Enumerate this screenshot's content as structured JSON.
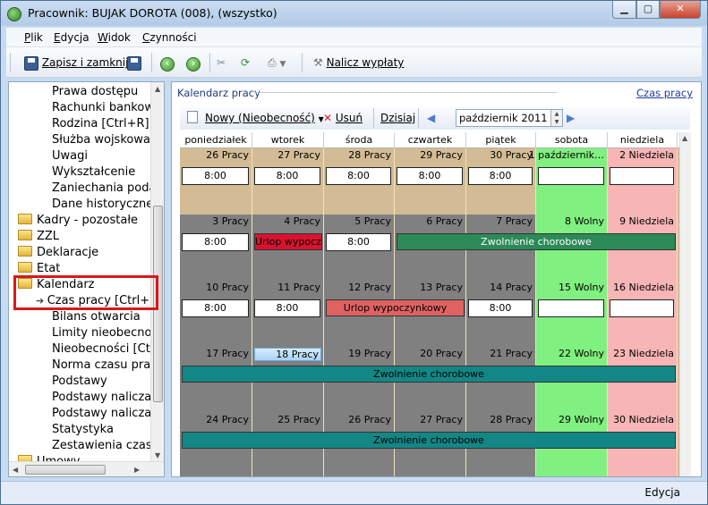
{
  "window": {
    "title": "Pracownik: BUJAK DOROTA (008), (wszystko)"
  },
  "menu": [
    {
      "label": "Plik",
      "key": "P",
      "rest": "lik"
    },
    {
      "label": "Edycja",
      "key": "E",
      "rest": "dycja"
    },
    {
      "label": "Widok",
      "key": "W",
      "rest": "idok"
    },
    {
      "label": "Czynności",
      "key": "C",
      "rest": "zynności"
    }
  ],
  "toolbar": {
    "save_close": "Zapisz i zamknij",
    "nalicz": "Nalicz wypłaty"
  },
  "tree": {
    "items": [
      {
        "label": "Prawa dostępu",
        "type": "item"
      },
      {
        "label": "Rachunki bankowe",
        "type": "item"
      },
      {
        "label": "Rodzina [Ctrl+R]",
        "type": "item"
      },
      {
        "label": "Służba wojskowa",
        "type": "item"
      },
      {
        "label": "Uwagi",
        "type": "item"
      },
      {
        "label": "Wykształcenie",
        "type": "item"
      },
      {
        "label": "Zaniechania poda",
        "type": "item"
      },
      {
        "label": "Dane historyczne",
        "type": "item"
      },
      {
        "label": "Kadry - pozostałe",
        "type": "folder"
      },
      {
        "label": "ZZL",
        "type": "folder"
      },
      {
        "label": "Deklaracje",
        "type": "folder"
      },
      {
        "label": "Etat",
        "type": "folder"
      },
      {
        "label": "Kalendarz",
        "type": "folder-open"
      },
      {
        "label": "Czas pracy [Ctrl+L]",
        "type": "selected"
      },
      {
        "label": "Bilans otwarcia",
        "type": "item"
      },
      {
        "label": "Limity nieobecności",
        "type": "item"
      },
      {
        "label": "Nieobecności [Ctrl",
        "type": "item"
      },
      {
        "label": "Norma czasu prac",
        "type": "item"
      },
      {
        "label": "Podstawy",
        "type": "item"
      },
      {
        "label": "Podstawy naliczan",
        "type": "item"
      },
      {
        "label": "Podstawy naliczan",
        "type": "item"
      },
      {
        "label": "Statystyka",
        "type": "item"
      },
      {
        "label": "Zestawienia czasu",
        "type": "item"
      },
      {
        "label": "Umowy",
        "type": "folder"
      }
    ]
  },
  "panel": {
    "title": "Kalendarz pracy",
    "czas_link": "Czas pracy"
  },
  "cal_toolbar": {
    "new": "Nowy (Nieobecność)",
    "delete": "Usuń",
    "today": "Dzisiaj",
    "month": "październik 2011"
  },
  "calendar": {
    "days": [
      "poniedziałek",
      "wtorek",
      "środa",
      "czwartek",
      "piątek",
      "sobota",
      "niedziela"
    ],
    "weeks": [
      {
        "labels": [
          "26 Pracy",
          "27 Pracy",
          "28 Pracy",
          "29 Pracy",
          "30 Pracy",
          "1 październik…",
          "2 Niedziela"
        ],
        "types": [
          "prev",
          "prev",
          "prev",
          "prev",
          "prev",
          "sat",
          "sun"
        ],
        "hours": [
          "8:00",
          "8:00",
          "8:00",
          "8:00",
          "8:00",
          "",
          ""
        ],
        "events": []
      },
      {
        "labels": [
          "3 Pracy",
          "4 Pracy",
          "5 Pracy",
          "6 Pracy",
          "7 Pracy",
          "8 Wolny",
          "9 Niedziela"
        ],
        "types": [
          "work",
          "work",
          "work",
          "work",
          "work",
          "sat",
          "sun"
        ],
        "hours": [
          "8:00",
          null,
          "8:00",
          null,
          null,
          null,
          null
        ],
        "events": [
          {
            "label": "Urlop wypoczy",
            "from": 1,
            "to": 1,
            "color": "#d8132f",
            "text": "#000"
          },
          {
            "label": "Zwolnienie chorobowe",
            "from": 3,
            "to": 6,
            "color": "#2b8a57",
            "text": "#fff"
          }
        ]
      },
      {
        "labels": [
          "10 Pracy",
          "11 Pracy",
          "12 Pracy",
          "13 Pracy",
          "14 Pracy",
          "15 Wolny",
          "16 Niedziela"
        ],
        "types": [
          "work",
          "work",
          "work",
          "work",
          "work",
          "sat",
          "sun"
        ],
        "hours": [
          "8:00",
          "8:00",
          null,
          null,
          "8:00",
          "",
          ""
        ],
        "events": [
          {
            "label": "Urlop wypoczynkowy",
            "from": 2,
            "to": 3,
            "color": "#e06262",
            "text": "#000"
          }
        ]
      },
      {
        "labels": [
          "17 Pracy",
          "18 Pracy",
          "19 Pracy",
          "20 Pracy",
          "21 Pracy",
          "22 Wolny",
          "23 Niedziela"
        ],
        "types": [
          "work",
          "today",
          "work",
          "work",
          "work",
          "sat",
          "sun"
        ],
        "hours": [
          null,
          null,
          null,
          null,
          null,
          null,
          null
        ],
        "events": [
          {
            "label": "Zwolnienie chorobowe",
            "from": 0,
            "to": 6,
            "color": "#138786",
            "text": "#000"
          }
        ]
      },
      {
        "labels": [
          "24 Pracy",
          "25 Pracy",
          "26 Pracy",
          "27 Pracy",
          "28 Pracy",
          "29 Wolny",
          "30 Niedziela"
        ],
        "types": [
          "work",
          "work",
          "work",
          "work",
          "work",
          "sat",
          "sun"
        ],
        "hours": [
          null,
          null,
          null,
          null,
          null,
          null,
          null
        ],
        "events": [
          {
            "label": "Zwolnienie chorobowe",
            "from": 0,
            "to": 6,
            "color": "#138786",
            "text": "#000"
          }
        ]
      }
    ]
  },
  "colors": {
    "prev": "#d3bc95",
    "work": "#808080",
    "sat": "#80f080",
    "sun": "#f7b5b5",
    "today": "#808080"
  },
  "status": {
    "mode": "Edycja"
  }
}
